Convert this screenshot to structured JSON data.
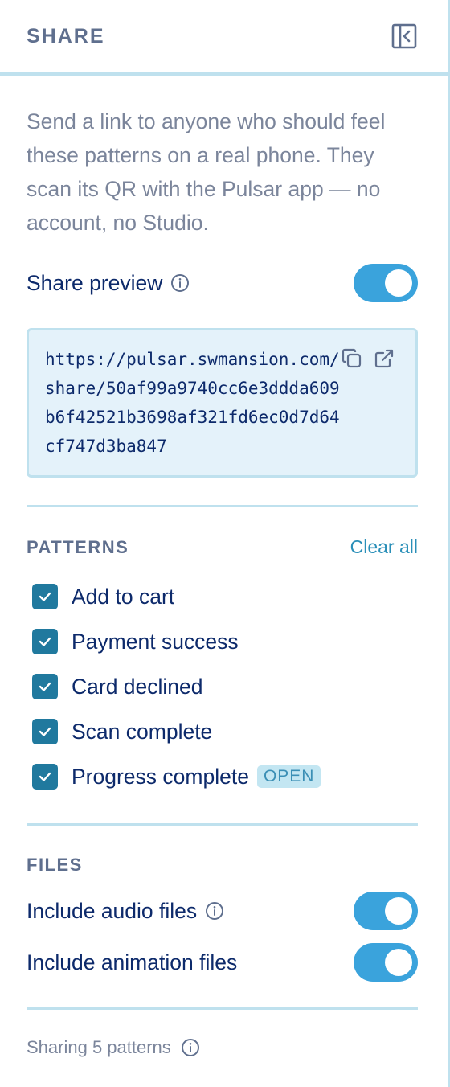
{
  "header": {
    "title": "SHARE",
    "collapse_icon": "sidebar-collapse-icon"
  },
  "intro": "Send a link to anyone who should feel these patterns on a real phone. They scan its QR with the Pulsar app — no account, no Studio.",
  "share_preview": {
    "label": "Share preview",
    "enabled": true
  },
  "share_url": "https://pulsar.swmansion.com/share/50af99a9740cc6e3ddda609b6f42521b3698af321fd6ec0d7d64cf747d3ba847",
  "patterns": {
    "title": "PATTERNS",
    "clear_all": "Clear all",
    "items": [
      {
        "label": "Add to cart",
        "checked": true
      },
      {
        "label": "Payment success",
        "checked": true
      },
      {
        "label": "Card declined",
        "checked": true
      },
      {
        "label": "Scan complete",
        "checked": true
      },
      {
        "label": "Progress complete",
        "checked": true,
        "badge": "OPEN"
      }
    ]
  },
  "files": {
    "title": "FILES",
    "audio": {
      "label": "Include audio files",
      "enabled": true
    },
    "animation": {
      "label": "Include animation files",
      "enabled": true
    }
  },
  "footer": {
    "text": "Sharing 5 patterns"
  },
  "colors": {
    "accent": "#3aa3dc",
    "checkbox": "#20799e",
    "border": "#bfe1ee",
    "url_bg": "#e4f2fa"
  }
}
